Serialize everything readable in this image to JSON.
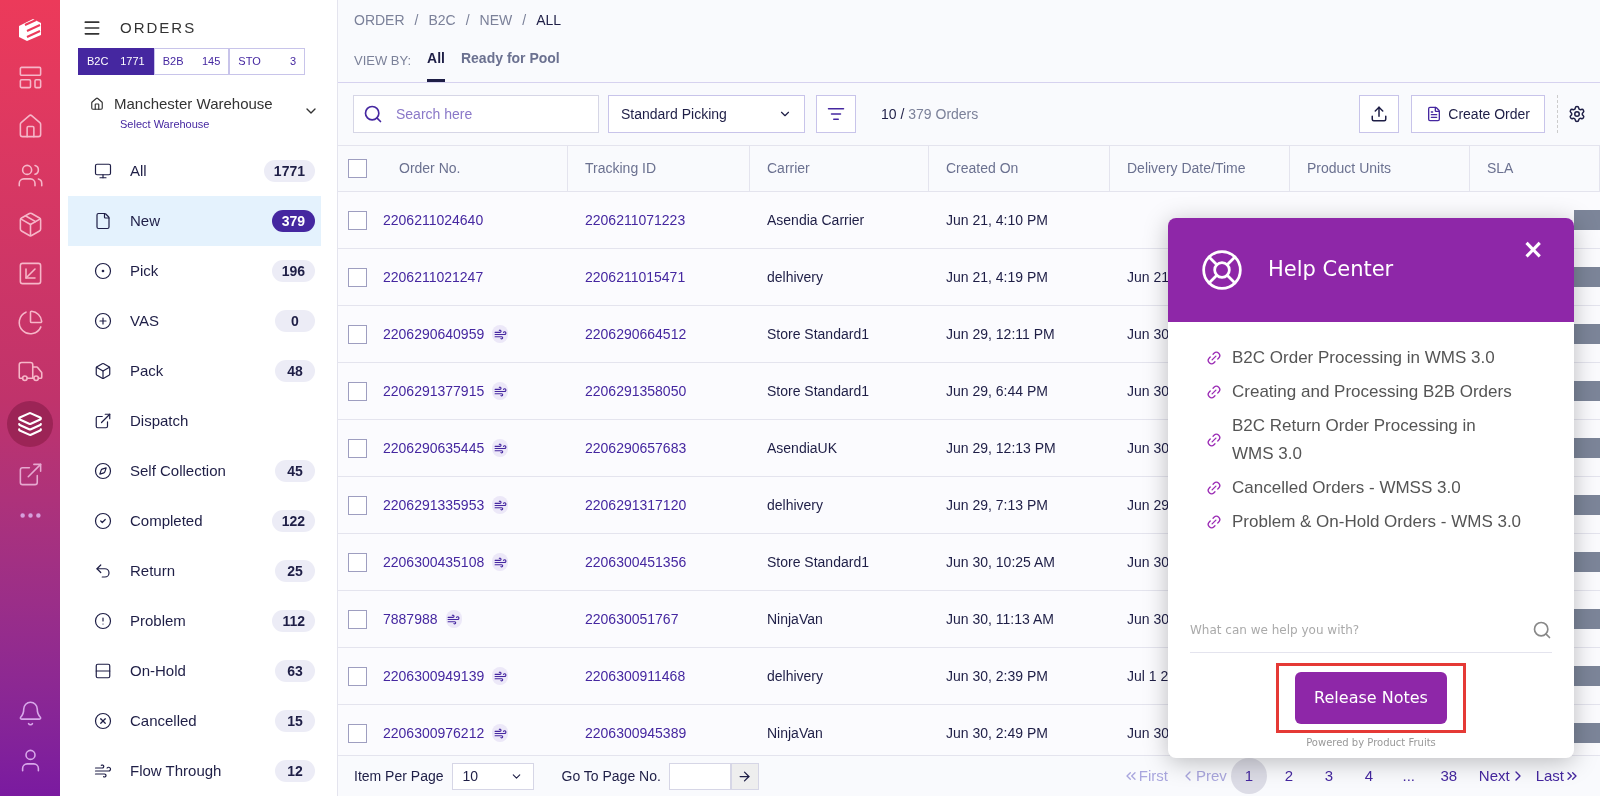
{
  "sidebar": {
    "title": "ORDERS",
    "segments": [
      {
        "label": "B2C",
        "count": "1771",
        "selected": true
      },
      {
        "label": "B2B",
        "count": "145",
        "selected": false
      },
      {
        "label": "STO",
        "count": "3",
        "selected": false
      }
    ],
    "warehouse": {
      "name": "Manchester Warehouse",
      "link": "Select Warehouse"
    },
    "items": [
      {
        "label": "All",
        "count": "1771",
        "selected": false
      },
      {
        "label": "New",
        "count": "379",
        "selected": true
      },
      {
        "label": "Pick",
        "count": "196",
        "selected": false
      },
      {
        "label": "VAS",
        "count": "0",
        "selected": false
      },
      {
        "label": "Pack",
        "count": "48",
        "selected": false
      },
      {
        "label": "Dispatch",
        "selected": false
      },
      {
        "label": "Self Collection",
        "count": "45",
        "selected": false
      },
      {
        "label": "Completed",
        "count": "122",
        "selected": false
      },
      {
        "label": "Return",
        "count": "25",
        "selected": false
      },
      {
        "label": "Problem",
        "count": "112",
        "selected": false
      },
      {
        "label": "On-Hold",
        "count": "63",
        "selected": false
      },
      {
        "label": "Cancelled",
        "count": "15",
        "selected": false
      },
      {
        "label": "Flow Through",
        "count": "12",
        "selected": false
      }
    ]
  },
  "breadcrumb": {
    "separator": "/",
    "items": [
      "ORDER",
      "B2C",
      "NEW",
      "ALL"
    ]
  },
  "view_by": {
    "label": "VIEW BY:",
    "tabs": [
      {
        "label": "All",
        "selected": true
      },
      {
        "label": "Ready for Pool",
        "selected": false
      }
    ]
  },
  "toolbar": {
    "search_placeholder": "Search here",
    "picking": "Standard Picking",
    "count": "10 /",
    "total": "379 Orders",
    "create": "Create Order"
  },
  "table": {
    "all_checked": false,
    "columns": [
      "Order No.",
      "Tracking ID",
      "Carrier",
      "Created On",
      "Delivery Date/Time",
      "Product Units",
      "SLA"
    ],
    "rows": [
      {
        "checked": false,
        "order": "2206211024640",
        "flow": false,
        "tracking": "2206211071223",
        "carrier": "Asendia Carrier",
        "created": "Jun 21, 4:10 PM"
      },
      {
        "checked": false,
        "order": "2206211021247",
        "flow": false,
        "tracking": "2206211015471",
        "carrier": "delhivery",
        "created": "Jun 21, 4:19 PM",
        "delivery": "Jun 21"
      },
      {
        "checked": false,
        "order": "2206290640959",
        "flow": true,
        "tracking": "2206290664512",
        "carrier": "Store Standard1",
        "created": "Jun 29, 12:11 PM",
        "delivery": "Jun 30"
      },
      {
        "checked": false,
        "order": "2206291377915",
        "flow": true,
        "tracking": "2206291358050",
        "carrier": "Store Standard1",
        "created": "Jun 29, 6:44 PM",
        "delivery": "Jun 30"
      },
      {
        "checked": false,
        "order": "2206290635445",
        "flow": true,
        "tracking": "2206290657683",
        "carrier": "AsendiaUK",
        "created": "Jun 29, 12:13 PM",
        "delivery": "Jun 30"
      },
      {
        "checked": false,
        "order": "2206291335953",
        "flow": true,
        "tracking": "2206291317120",
        "carrier": "delhivery",
        "created": "Jun 29, 7:13 PM",
        "delivery": "Jun 29"
      },
      {
        "checked": false,
        "order": "2206300435108",
        "flow": true,
        "tracking": "2206300451356",
        "carrier": "Store Standard1",
        "created": "Jun 30, 10:25 AM",
        "delivery": "Jun 30"
      },
      {
        "checked": false,
        "order": "7887988",
        "flow": true,
        "tracking": "220630051767",
        "carrier": "NinjaVan",
        "created": "Jun 30, 11:13 AM",
        "delivery": "Jun 30"
      },
      {
        "checked": false,
        "order": "2206300949139",
        "flow": true,
        "tracking": "2206300911468",
        "carrier": "delhivery",
        "created": "Jun 30, 2:39 PM",
        "delivery": "Jul 1 2"
      },
      {
        "checked": false,
        "order": "2206300976212",
        "flow": true,
        "tracking": "2206300945389",
        "carrier": "NinjaVan",
        "created": "Jun 30, 2:49 PM",
        "delivery": "Jun 30"
      }
    ]
  },
  "footer": {
    "per_page_label": "Item Per Page",
    "per_page": "10",
    "goto_label": "Go To Page No.",
    "first": "First",
    "prev": "Prev",
    "pages": [
      {
        "label": "1",
        "selected": true
      },
      {
        "label": "2",
        "selected": false
      },
      {
        "label": "3",
        "selected": false
      },
      {
        "label": "4",
        "selected": false
      },
      {
        "label": "...",
        "selected": false
      },
      {
        "label": "38",
        "selected": false
      }
    ],
    "next": "Next",
    "last": "Last"
  },
  "help_center": {
    "title": "Help Center",
    "close": "×",
    "links": [
      "B2C Order Processing in WMS 3.0",
      "Creating and Processing B2B Orders",
      "B2C Return Order Processing in WMS 3.0",
      "Cancelled Orders - WMSS 3.0",
      "Problem & On-Hold Orders - WMS 3.0"
    ],
    "search_placeholder": "What can we help you with?",
    "button": "Release Notes",
    "powered_by": "Powered by Product Fruits"
  }
}
